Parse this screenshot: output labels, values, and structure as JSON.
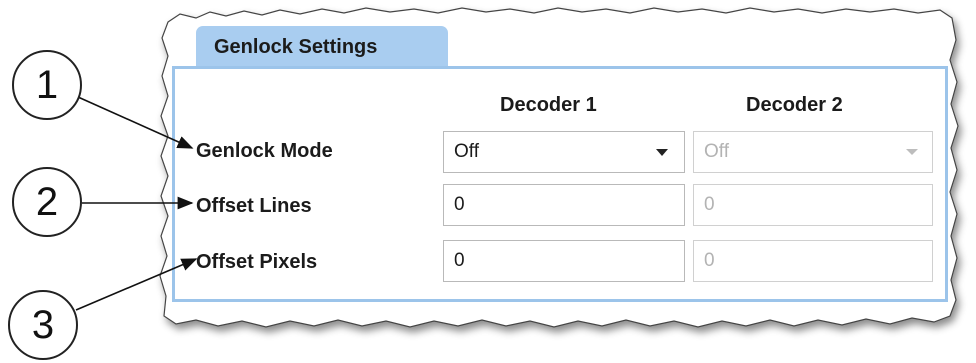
{
  "panel": {
    "tab_title": "Genlock Settings",
    "columns": [
      "Decoder 1",
      "Decoder 2"
    ]
  },
  "rows": [
    {
      "label": "Genlock Mode",
      "decoder1": "Off",
      "decoder2": "Off",
      "type": "select"
    },
    {
      "label": "Offset Lines",
      "decoder1": "0",
      "decoder2": "0",
      "type": "input"
    },
    {
      "label": "Offset Pixels",
      "decoder1": "0",
      "decoder2": "0",
      "type": "input"
    }
  ],
  "callouts": [
    "1",
    "2",
    "3"
  ],
  "colors": {
    "tab_bg": "#a9cdf0",
    "panel_border": "#9cc4ea",
    "disabled_text": "#b3b3b3"
  }
}
